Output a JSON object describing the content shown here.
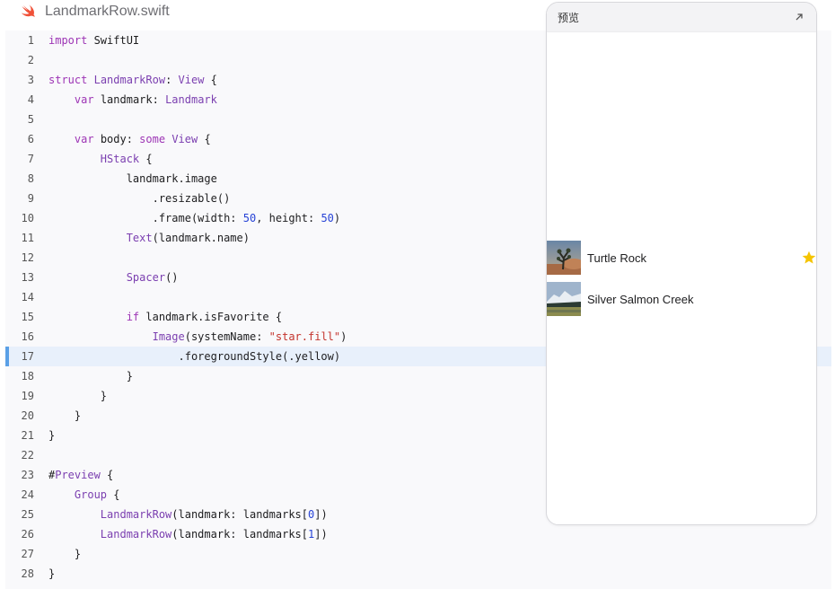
{
  "file": {
    "name": "LandmarkRow.swift",
    "icon": "swift-logo-icon"
  },
  "editor": {
    "active_line": 17,
    "lines": [
      {
        "n": "1",
        "t": "import SwiftUI"
      },
      {
        "n": "2",
        "t": ""
      },
      {
        "n": "3",
        "t": "struct LandmarkRow: View {"
      },
      {
        "n": "4",
        "t": "    var landmark: Landmark"
      },
      {
        "n": "5",
        "t": ""
      },
      {
        "n": "6",
        "t": "    var body: some View {"
      },
      {
        "n": "7",
        "t": "        HStack {"
      },
      {
        "n": "8",
        "t": "            landmark.image"
      },
      {
        "n": "9",
        "t": "                .resizable()"
      },
      {
        "n": "10",
        "t": "                .frame(width: 50, height: 50)"
      },
      {
        "n": "11",
        "t": "            Text(landmark.name)"
      },
      {
        "n": "12",
        "t": ""
      },
      {
        "n": "13",
        "t": "            Spacer()"
      },
      {
        "n": "14",
        "t": ""
      },
      {
        "n": "15",
        "t": "            if landmark.isFavorite {"
      },
      {
        "n": "16",
        "t": "                Image(systemName: \"star.fill\")"
      },
      {
        "n": "17",
        "t": "                    .foregroundStyle(.yellow)"
      },
      {
        "n": "18",
        "t": "            }"
      },
      {
        "n": "19",
        "t": "        }"
      },
      {
        "n": "20",
        "t": "    }"
      },
      {
        "n": "21",
        "t": "}"
      },
      {
        "n": "22",
        "t": ""
      },
      {
        "n": "23",
        "t": "#Preview {"
      },
      {
        "n": "24",
        "t": "    Group {"
      },
      {
        "n": "25",
        "t": "        LandmarkRow(landmark: landmarks[0])"
      },
      {
        "n": "26",
        "t": "        LandmarkRow(landmark: landmarks[1])"
      },
      {
        "n": "27",
        "t": "    }"
      },
      {
        "n": "28",
        "t": "}"
      }
    ]
  },
  "preview": {
    "title": "预览",
    "expand_icon": "expand-arrow-icon",
    "rows": [
      {
        "name": "Turtle Rock",
        "favorite": true,
        "thumb_icon": "turtle-rock-image"
      },
      {
        "name": "Silver Salmon Creek",
        "favorite": false,
        "thumb_icon": "silver-salmon-creek-image"
      }
    ],
    "star_color": "#f5c400"
  },
  "colors": {
    "keyword": "#9d35b5",
    "type": "#7b3fb0",
    "number": "#2743d6",
    "string": "#c4342d",
    "accent": "#5aa0e6"
  }
}
